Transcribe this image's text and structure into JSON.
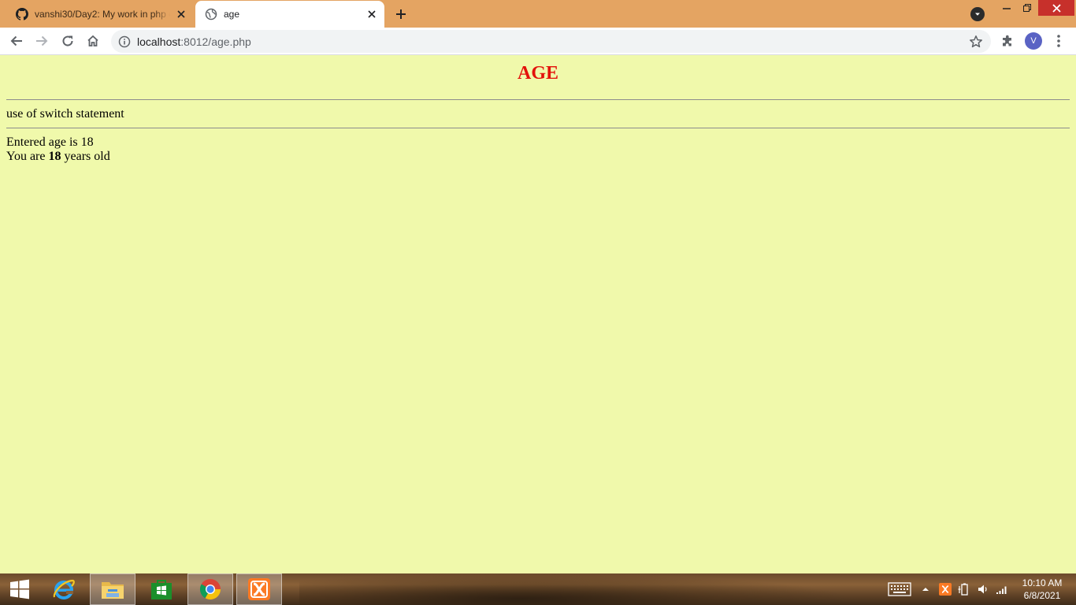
{
  "browser": {
    "tabs": [
      {
        "title": "vanshi30/Day2: My work in php c",
        "icon": "github-icon",
        "active": false
      },
      {
        "title": "age",
        "icon": "globe-icon",
        "active": true
      }
    ],
    "address": {
      "host": "localhost",
      "path": ":8012/age.php"
    },
    "profile_initial": "V",
    "frame_color": "#e4a462"
  },
  "page": {
    "heading": "AGE",
    "heading_color": "#e3120b",
    "background": "#f0f9ab",
    "subtitle": "use of switch statement",
    "entered_line": "Entered age is 18",
    "result_prefix": "You are ",
    "result_age": "18",
    "result_suffix": " years old"
  },
  "taskbar": {
    "apps": [
      "internet-explorer-icon",
      "file-explorer-icon",
      "store-icon",
      "chrome-icon",
      "xampp-icon"
    ],
    "clock_time": "10:10 AM",
    "clock_date": "6/8/2021"
  }
}
